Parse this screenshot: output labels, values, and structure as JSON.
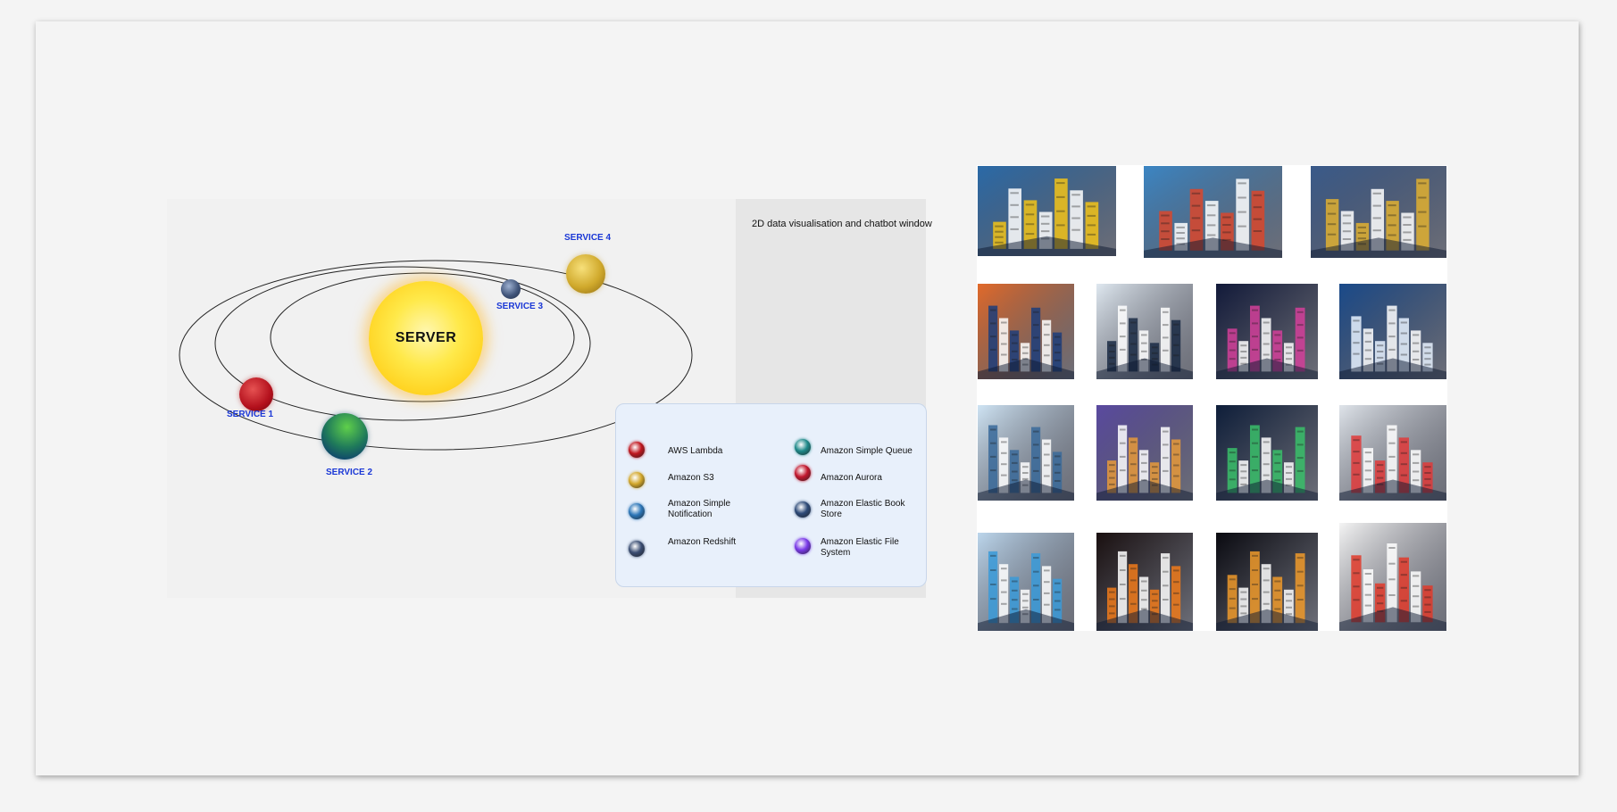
{
  "chat_window": {
    "title": "2D data visualisation and chatbot window"
  },
  "diagram": {
    "center_label": "SERVER",
    "services": [
      {
        "label": "SERVICE 1"
      },
      {
        "label": "SERVICE 2"
      },
      {
        "label": "SERVICE 3"
      },
      {
        "label": "SERVICE 4"
      }
    ]
  },
  "legend": {
    "items": [
      {
        "label": "AWS Lambda",
        "color": "#c0171f"
      },
      {
        "label": "Amazon Simple Queue",
        "color": "#1f8a8a"
      },
      {
        "label": "Amazon S3",
        "color": "#d3a82c"
      },
      {
        "label": "Amazon Aurora",
        "color": "#c2182e"
      },
      {
        "label": "Amazon Simple Notification",
        "color": "#2c76b8"
      },
      {
        "label": "Amazon Elastic Book Store",
        "color": "#2d4a78"
      },
      {
        "label": "Amazon Redshift",
        "color": "#3a4d72"
      },
      {
        "label": "Amazon Elastic File System",
        "color": "#7a3ae8"
      }
    ]
  },
  "gallery": {
    "images": [
      {
        "name": "isometric-blue-yellow-tower-image",
        "bg": "#2a6aa8",
        "accent": "#f2c318"
      },
      {
        "name": "isometric-blue-circuit-building-image",
        "bg": "#3c86c4",
        "accent": "#d9472c"
      },
      {
        "name": "isometric-gold-city-image",
        "bg": "#3a5a8a",
        "accent": "#e0b030"
      },
      {
        "name": "isometric-orange-city-image",
        "bg": "#e26a2a",
        "accent": "#1d3d7a"
      },
      {
        "name": "isometric-white-skyscraper-image",
        "bg": "#dfe8f0",
        "accent": "#1a2a44"
      },
      {
        "name": "isometric-neon-city-image",
        "bg": "#121a3a",
        "accent": "#d4409a"
      },
      {
        "name": "isometric-blue-skyline-image",
        "bg": "#1a4a8a",
        "accent": "#e8f2ff"
      },
      {
        "name": "isometric-snow-city-image",
        "bg": "#cfe4f4",
        "accent": "#3a6a9a"
      },
      {
        "name": "isometric-purple-city-image",
        "bg": "#5a4aa0",
        "accent": "#e89a3a"
      },
      {
        "name": "isometric-green-lit-city-image",
        "bg": "#0e1e3a",
        "accent": "#3ac06a"
      },
      {
        "name": "isometric-colorful-building-image",
        "bg": "#dfe4ea",
        "accent": "#e03a3a"
      },
      {
        "name": "rainbow-towers-clouds-image",
        "bg": "#bcd6ec",
        "accent": "#3a9ad8"
      },
      {
        "name": "sun-over-city-image",
        "bg": "#1a1010",
        "accent": "#f07a1a"
      },
      {
        "name": "solar-system-image",
        "bg": "#0a0a10",
        "accent": "#f09a2a"
      },
      {
        "name": "storage-shelf-blocks-image",
        "bg": "#f4f4f4",
        "accent": "#e03a2a"
      }
    ]
  }
}
